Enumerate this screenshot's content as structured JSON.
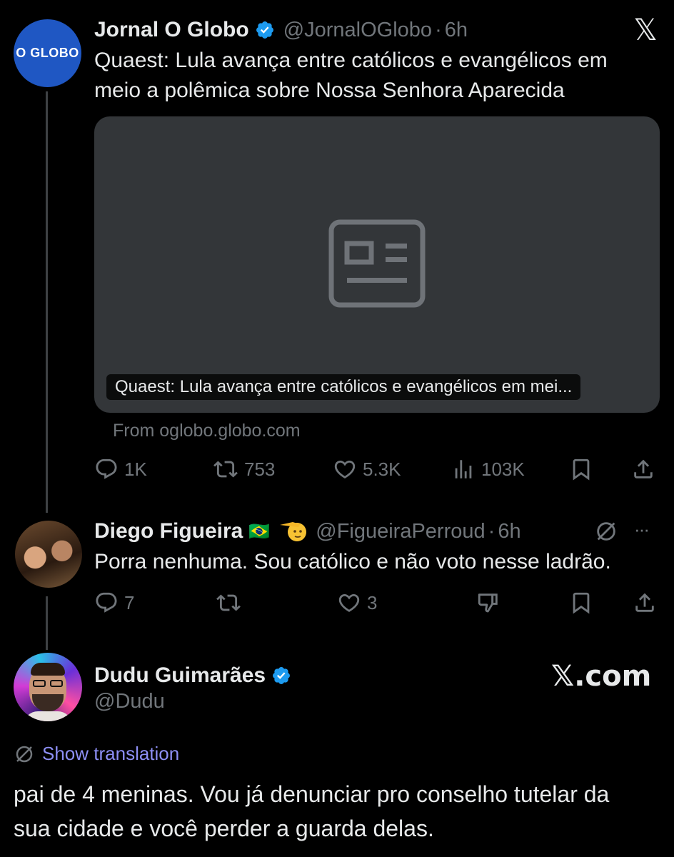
{
  "tweet1": {
    "avatar_text": "O GLOBO",
    "name": "Jornal O Globo",
    "handle": "@JornalOGlobo",
    "separator": "·",
    "time": "6h",
    "text": "Quaest: Lula avança entre católicos e evangélicos em meio a polêmica sobre Nossa Senhora Aparecida",
    "card_caption": "Quaest: Lula avança entre católicos e evangélicos em mei...",
    "card_source": "From oglobo.globo.com",
    "actions": {
      "replies": "1K",
      "retweets": "753",
      "likes": "5.3K",
      "views": "103K"
    }
  },
  "tweet2": {
    "name": "Diego Figueira",
    "flag": "🇧🇷",
    "handle": "@FigueiraPerroud",
    "separator": "·",
    "time": "6h",
    "text": "Porra nenhuma. Sou católico e não voto nesse ladrão.",
    "more": "···",
    "actions": {
      "replies": "7",
      "likes": "3"
    }
  },
  "tweet3": {
    "name": "Dudu Guimarães",
    "handle": "@Dudu",
    "show_translation": "Show translation",
    "text": "pai de 4 meninas. Vou já denunciar pro conselho tutelar da sua cidade e você perder a guarda delas.",
    "watermark": "𝕏.com"
  },
  "close_glyph": "𝕏",
  "colors": {
    "background": "#000000",
    "verified": "#1d9bf0",
    "muted": "#71767b",
    "link": "#8d8ff5",
    "card": "#333639"
  }
}
